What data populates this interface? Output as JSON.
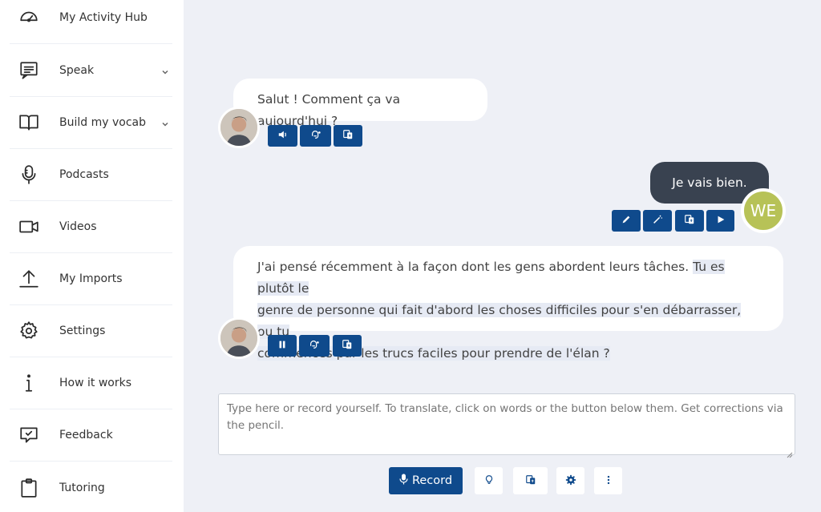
{
  "sidebar": {
    "items": [
      {
        "label": "My Activity Hub",
        "icon": "dashboard-gauge-icon"
      },
      {
        "label": "Speak",
        "icon": "chat-message-icon",
        "has_submenu": true
      },
      {
        "label": "Build my vocab",
        "icon": "open-book-icon",
        "has_submenu": true
      },
      {
        "label": "Podcasts",
        "icon": "microphone-icon"
      },
      {
        "label": "Videos",
        "icon": "video-camera-icon"
      },
      {
        "label": "My Imports",
        "icon": "upload-arrow-icon"
      },
      {
        "label": "Settings",
        "icon": "gear-icon"
      },
      {
        "label": "How it works",
        "icon": "info-icon"
      },
      {
        "label": "Feedback",
        "icon": "feedback-bubble-icon"
      },
      {
        "label": "Tutoring",
        "icon": "clipboard-icon"
      }
    ]
  },
  "chat": {
    "messages": [
      {
        "sender": "tutor",
        "text": "Salut ! Comment ça va aujourd'hui ?",
        "actions": [
          "speaker-icon",
          "speech-settings-icon",
          "translate-icon"
        ]
      },
      {
        "sender": "user",
        "avatar_initials": "WE",
        "text": "Je vais bien.",
        "actions": [
          "pencil-icon",
          "magic-wand-icon",
          "translate-icon",
          "play-icon"
        ]
      },
      {
        "sender": "tutor",
        "text_plain": "J'ai pensé récemment à la façon dont les gens abordent leurs tâches. ",
        "text_highlighted_1": "Tu es plutôt le",
        "text_highlighted_2": "genre de personne qui fait d'abord les choses difficiles pour s'en débarrasser, ou tu",
        "text_highlighted_3": "commences par les trucs faciles pour prendre de l'élan ?",
        "actions": [
          "pause-icon",
          "speech-settings-icon",
          "translate-icon"
        ]
      }
    ]
  },
  "composer": {
    "placeholder": "Type here or record yourself. To translate, click on words or the button below them. Get corrections via the pencil.",
    "record_label": "Record",
    "tools": [
      "lightbulb-icon",
      "translate-icon",
      "gear-icon",
      "more-vertical-icon"
    ]
  },
  "colors": {
    "accent": "#0f4a8c",
    "user_bubble": "#394250",
    "user_avatar": "#b7c257",
    "background": "#eef0f6"
  }
}
